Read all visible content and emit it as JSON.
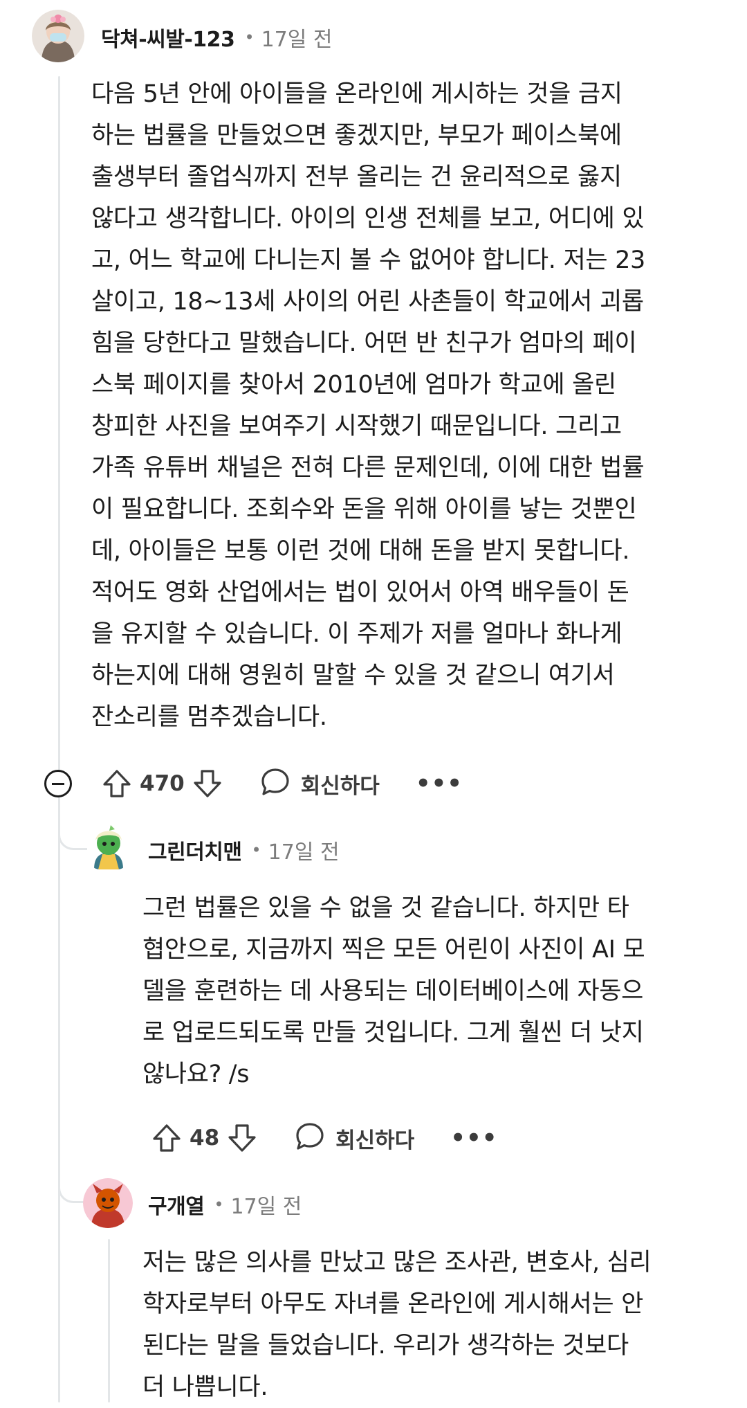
{
  "comments": [
    {
      "username": "닥쳐-씨발-123",
      "time": "17일 전",
      "lines": [
        "다음 5년 안에 아이들을 온라인에 게시하는 것을 금지",
        "하는 법률을 만들었으면 좋겠지만, 부모가 페이스북에",
        "출생부터 졸업식까지 전부 올리는 건 윤리적으로 옳지",
        "않다고 생각합니다. 아이의 인생 전체를 보고, 어디에 있",
        "고, 어느 학교에 다니는지 볼 수 없어야 합니다. 저는 23",
        "살이고, 18~13세 사이의 어린 사촌들이 학교에서 괴롭",
        "힘을 당한다고 말했습니다. 어떤 반 친구가 엄마의 페이",
        "스북 페이지를 찾아서 2010년에 엄마가 학교에 올린",
        "창피한 사진을 보여주기 시작했기 때문입니다. 그리고",
        "가족 유튜버 채널은 전혀 다른 문제인데, 이에 대한 법률",
        "이 필요합니다. 조회수와 돈을 위해 아이를 낳는 것뿐인",
        "데, 아이들은 보통 이런 것에 대해 돈을 받지 못합니다.",
        "적어도 영화 산업에서는 법이 있어서 아역 배우들이 돈",
        "을 유지할 수 있습니다. 이 주제가 저를 얼마나 화나게",
        "하는지에 대해 영원히 말할 수 있을 것 같으니 여기서",
        "잔소리를 멈추겠습니다."
      ],
      "score": "470",
      "reply_label": "회신하다",
      "more": "•••"
    },
    {
      "username": "그린더치맨",
      "time": "17일 전",
      "lines": [
        "그런 법률은 있을 수 없을 것 같습니다. 하지만 타",
        "협안으로, 지금까지 찍은 모든 어린이 사진이 AI 모",
        "델을 훈련하는 데 사용되는 데이터베이스에 자동으",
        "로 업로드되도록 만들 것입니다. 그게 훨씬 더 낫지",
        "않나요? /s"
      ],
      "score": "48",
      "reply_label": "회신하다",
      "more": "•••"
    },
    {
      "username": "구개열",
      "time": "17일 전",
      "lines": [
        "저는 많은 의사를 만났고 많은 조사관, 변호사, 심리",
        "학자로부터 아무도 자녀를 온라인에 게시해서는 안",
        "된다는 말을 들었습니다. 우리가 생각하는 것보다",
        "더 나쁩니다."
      ]
    }
  ],
  "icons": {
    "collapse": "collapse-minus-icon",
    "upvote": "upvote-arrow-icon",
    "downvote": "downvote-arrow-icon",
    "reply": "speech-bubble-icon",
    "more": "more-dots-icon"
  },
  "colors": {
    "thread_line": "#e3e6e8",
    "meta_text": "#7c7c7c",
    "action_text": "#3c3c3c"
  }
}
